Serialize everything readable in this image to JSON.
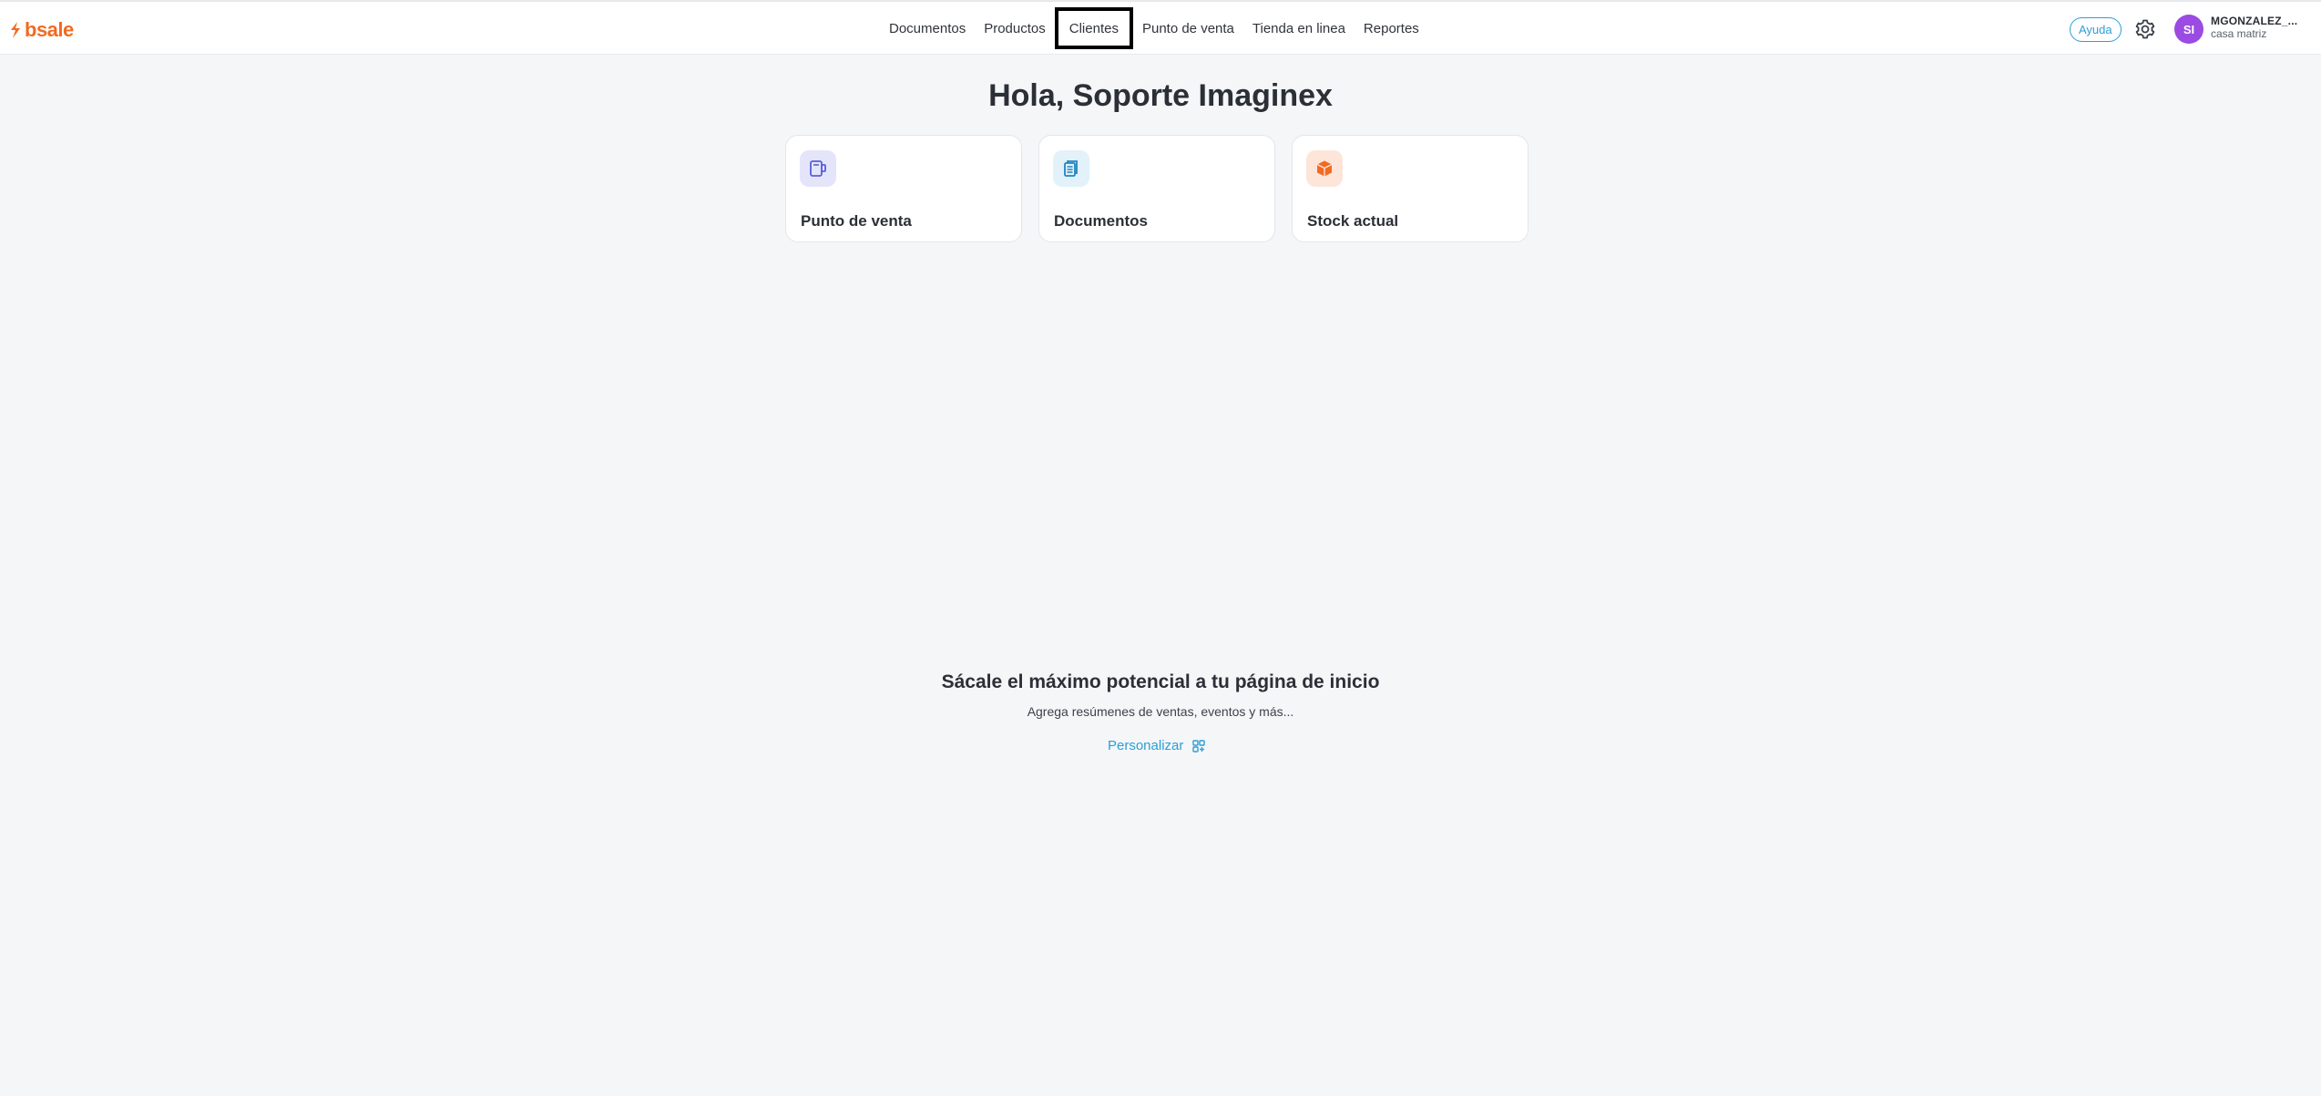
{
  "brand": {
    "name": "bsale",
    "color": "#f26a21"
  },
  "nav": {
    "items": [
      {
        "label": "Documentos"
      },
      {
        "label": "Productos"
      },
      {
        "label": "Clientes",
        "active": true
      },
      {
        "label": "Punto de venta"
      },
      {
        "label": "Tienda en linea"
      },
      {
        "label": "Reportes"
      }
    ]
  },
  "header": {
    "help_label": "Ayuda",
    "settings_icon": "gear-icon",
    "avatar_initials": "SI",
    "user_name": "MGONZALEZ_...",
    "branch": "casa matriz"
  },
  "main": {
    "greeting": "Hola, Soporte Imaginex",
    "cards": [
      {
        "label": "Punto de venta",
        "icon": "pos-device-icon",
        "icon_bg": "#e4e5fb",
        "icon_color": "#5b5fd6"
      },
      {
        "label": "Documentos",
        "icon": "documents-icon",
        "icon_bg": "#e2f1fa",
        "icon_color": "#1f86c2"
      },
      {
        "label": "Stock actual",
        "icon": "box-icon",
        "icon_bg": "#fde5da",
        "icon_color": "#f26a21"
      }
    ],
    "promo": {
      "title": "Sácale el máximo potencial a tu página de inicio",
      "subtitle": "Agrega resúmenes de ventas, eventos y más...",
      "link_label": "Personalizar",
      "link_icon": "widgets-grid-icon"
    }
  },
  "colors": {
    "accent": "#2a9fd6",
    "avatar": "#9b4ae2",
    "background": "#f4f6f8"
  }
}
